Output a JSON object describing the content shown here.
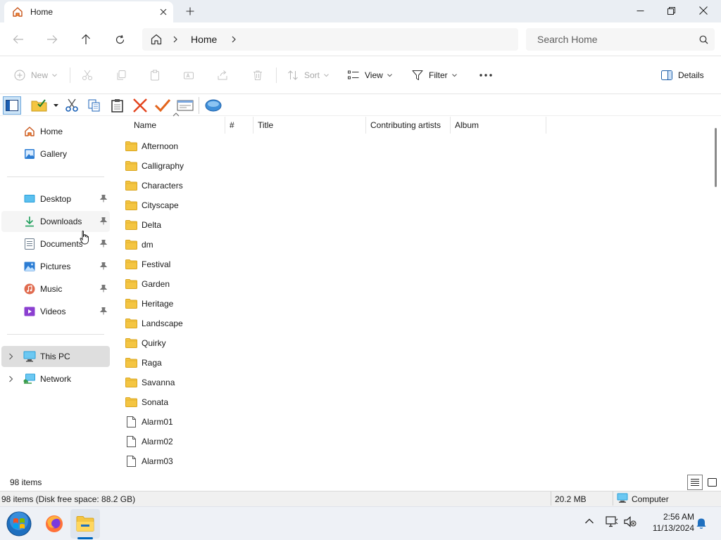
{
  "window": {
    "tab_title": "Home"
  },
  "navigation": {
    "breadcrumb": [
      "Home"
    ],
    "search_placeholder": "Search Home"
  },
  "command_bar": {
    "new_label": "New",
    "sort_label": "Sort",
    "view_label": "View",
    "filter_label": "Filter",
    "details_label": "Details"
  },
  "sidebar": {
    "quick": [
      {
        "label": "Home",
        "icon": "home-icon"
      },
      {
        "label": "Gallery",
        "icon": "gallery-icon"
      }
    ],
    "pinned": [
      {
        "label": "Desktop",
        "icon": "desktop-icon"
      },
      {
        "label": "Downloads",
        "icon": "downloads-icon"
      },
      {
        "label": "Documents",
        "icon": "documents-icon"
      },
      {
        "label": "Pictures",
        "icon": "pictures-icon"
      },
      {
        "label": "Music",
        "icon": "music-icon"
      },
      {
        "label": "Videos",
        "icon": "videos-icon"
      }
    ],
    "devices": [
      {
        "label": "This PC",
        "icon": "pc-icon"
      },
      {
        "label": "Network",
        "icon": "network-icon"
      }
    ]
  },
  "columns": [
    "Name",
    "#",
    "Title",
    "Contributing artists",
    "Album"
  ],
  "files": [
    {
      "name": "Afternoon",
      "type": "folder"
    },
    {
      "name": "Calligraphy",
      "type": "folder"
    },
    {
      "name": "Characters",
      "type": "folder"
    },
    {
      "name": "Cityscape",
      "type": "folder"
    },
    {
      "name": "Delta",
      "type": "folder"
    },
    {
      "name": "dm",
      "type": "folder"
    },
    {
      "name": "Festival",
      "type": "folder"
    },
    {
      "name": "Garden",
      "type": "folder"
    },
    {
      "name": "Heritage",
      "type": "folder"
    },
    {
      "name": "Landscape",
      "type": "folder"
    },
    {
      "name": "Quirky",
      "type": "folder"
    },
    {
      "name": "Raga",
      "type": "folder"
    },
    {
      "name": "Savanna",
      "type": "folder"
    },
    {
      "name": "Sonata",
      "type": "folder"
    },
    {
      "name": "Alarm01",
      "type": "file"
    },
    {
      "name": "Alarm02",
      "type": "file"
    },
    {
      "name": "Alarm03",
      "type": "file"
    }
  ],
  "status": {
    "item_count": "98 items",
    "detail_left": "98 items (Disk free space: 88.2 GB)",
    "size": "20.2 MB",
    "location": "Computer"
  },
  "taskbar": {
    "time": "2:56 AM",
    "date": "11/13/2024"
  },
  "colors": {
    "folder": "#f4c542",
    "accent": "#0067c0",
    "selected_nav": "#dedede"
  }
}
